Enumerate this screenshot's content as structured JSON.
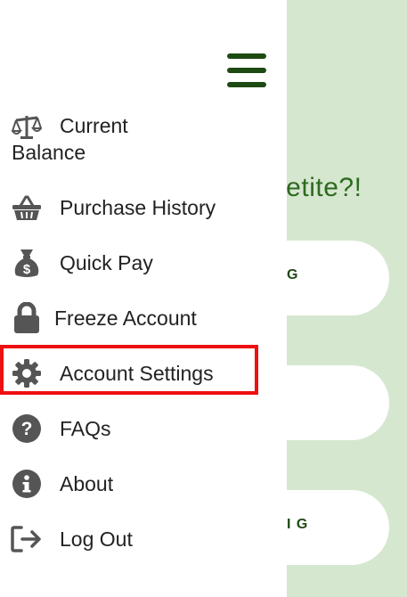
{
  "background": {
    "title": "petite?!",
    "cards": [
      {
        "label": "G"
      },
      {
        "label": ""
      },
      {
        "label": "I G"
      }
    ]
  },
  "drawer": {
    "menu_icon": "hamburger-icon",
    "items": [
      {
        "label_line1": "Current",
        "label_line2": "Balance",
        "icon": "balance-scale-icon"
      },
      {
        "label": "Purchase History",
        "icon": "basket-icon"
      },
      {
        "label": "Quick Pay",
        "icon": "money-bag-icon"
      },
      {
        "label": "Freeze Account",
        "icon": "lock-icon"
      },
      {
        "label": "Account Settings",
        "icon": "gear-icon",
        "highlighted": true
      },
      {
        "label": "FAQs",
        "icon": "question-circle-icon"
      },
      {
        "label": "About",
        "icon": "info-circle-icon"
      },
      {
        "label": "Log Out",
        "icon": "logout-icon"
      }
    ]
  },
  "colors": {
    "accent_green": "#1d4a12",
    "background_green": "#d6e7d0",
    "icon_gray": "#555555",
    "highlight_red": "#ee1010"
  }
}
